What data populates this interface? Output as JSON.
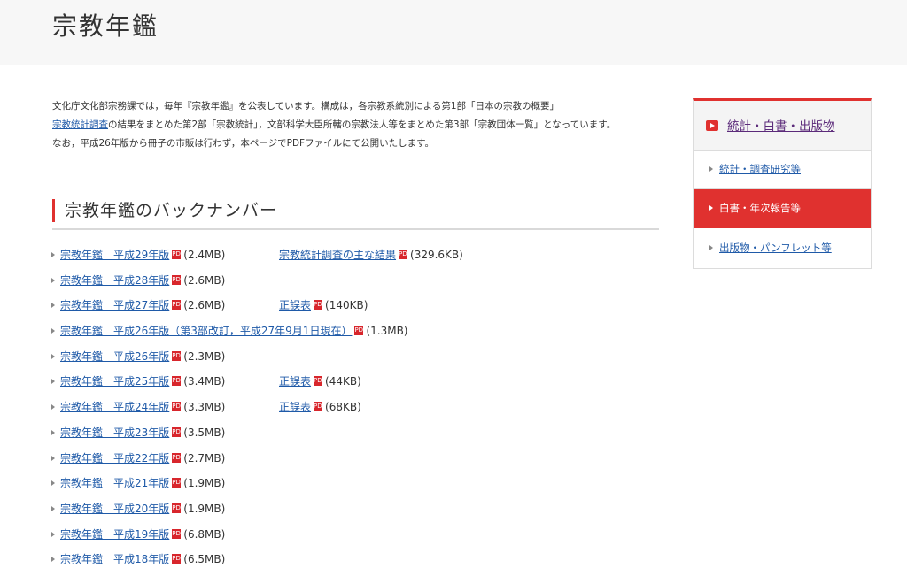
{
  "header": {
    "title": "宗教年鑑"
  },
  "intro": {
    "line1": "文化庁文化部宗務課では，毎年『宗教年鑑』を公表しています。構成は，各宗教系統別による第1部「日本の宗教の概要」",
    "line2_link": "宗教統計調査",
    "line2_rest": "の結果をまとめた第2部「宗教統計」，文部科学大臣所轄の宗教法人等をまとめた第3部「宗教団体一覧」となっています。",
    "line3": "なお，平成26年版から冊子の市販は行わず，本ページでPDFファイルにて公開いたします。"
  },
  "section": {
    "heading": "宗教年鑑のバックナンバー"
  },
  "pdf_icon_text": "PDF",
  "backnumbers": [
    {
      "title": "宗教年鑑　平成29年版",
      "size": "(2.4MB)",
      "extra_title": "宗教統計調査の主な結果",
      "extra_size": "(329.6KB)"
    },
    {
      "title": "宗教年鑑　平成28年版",
      "size": "(2.6MB)"
    },
    {
      "title": "宗教年鑑　平成27年版",
      "size": "(2.6MB)",
      "extra_title": "正誤表",
      "extra_size": "(140KB)"
    },
    {
      "title": "宗教年鑑　平成26年版（第3部改訂，平成27年9月1日現在）",
      "size": "(1.3MB)"
    },
    {
      "title": "宗教年鑑　平成26年版",
      "size": "(2.3MB)"
    },
    {
      "title": "宗教年鑑　平成25年版",
      "size": "(3.4MB)",
      "extra_title": "正誤表",
      "extra_size": "(44KB)"
    },
    {
      "title": "宗教年鑑　平成24年版",
      "size": "(3.3MB)",
      "extra_title": "正誤表",
      "extra_size": "(68KB)"
    },
    {
      "title": "宗教年鑑　平成23年版",
      "size": "(3.5MB)"
    },
    {
      "title": "宗教年鑑　平成22年版",
      "size": "(2.7MB)"
    },
    {
      "title": "宗教年鑑　平成21年版",
      "size": "(1.9MB)"
    },
    {
      "title": "宗教年鑑　平成20年版",
      "size": "(1.9MB)"
    },
    {
      "title": "宗教年鑑　平成19年版",
      "size": "(6.8MB)"
    },
    {
      "title": "宗教年鑑　平成18年版",
      "size": "(6.5MB)"
    }
  ],
  "sidebar": {
    "heading": "統計・白書・出版物",
    "items": [
      {
        "label": "統計・調査研究等",
        "active": false
      },
      {
        "label": "白書・年次報告等",
        "active": true
      },
      {
        "label": "出版物・パンフレット等",
        "active": false
      }
    ]
  },
  "colors": {
    "accent": "#e0312f",
    "link": "#1f5aa8",
    "visited_link": "#5b2a7a",
    "pdf_icon": "#d8262c"
  }
}
